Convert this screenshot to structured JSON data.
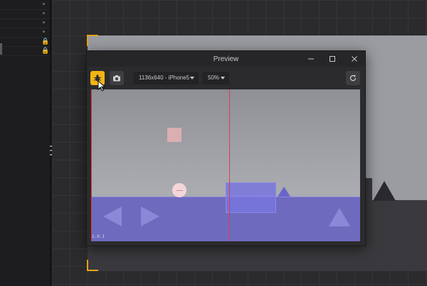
{
  "preview": {
    "title": "Preview",
    "resolution": "1136x640 - iPhone5",
    "zoom": "50%",
    "corner_label": "1.0.1"
  },
  "icons": {
    "debug": "bug-icon",
    "camera": "camera-icon",
    "refresh": "refresh-icon",
    "minimize": "minimize-icon",
    "maximize": "maximize-icon",
    "close": "close-icon",
    "lock": "lock-icon",
    "cursor": "mouse-pointer-icon"
  },
  "colors": {
    "accent": "#f2b414",
    "guide_line": "#e23a4c",
    "water": "#6864be"
  }
}
